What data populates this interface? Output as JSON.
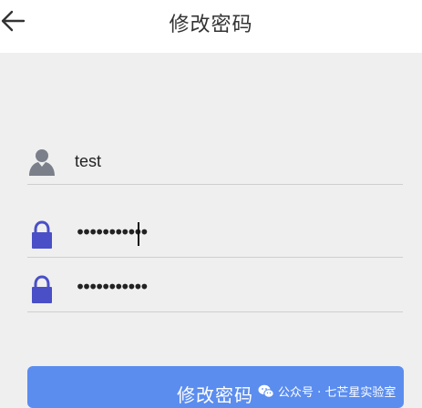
{
  "header": {
    "title": "修改密码",
    "back_icon": "arrow-left-icon"
  },
  "form": {
    "username": {
      "icon": "user-icon",
      "value": "test"
    },
    "password": {
      "icon": "lock-icon",
      "value": "•••••••••••"
    },
    "confirm_password": {
      "icon": "lock-icon",
      "value": "•••••••••••"
    }
  },
  "submit": {
    "label": "修改密码"
  },
  "watermark": {
    "text": "公众号 · 七芒星实验室",
    "icon": "wechat-icon"
  },
  "colors": {
    "accent": "#5b8def",
    "icon_blue": "#4a4fc7",
    "icon_gray": "#7a7f8a",
    "background": "#efefef"
  }
}
